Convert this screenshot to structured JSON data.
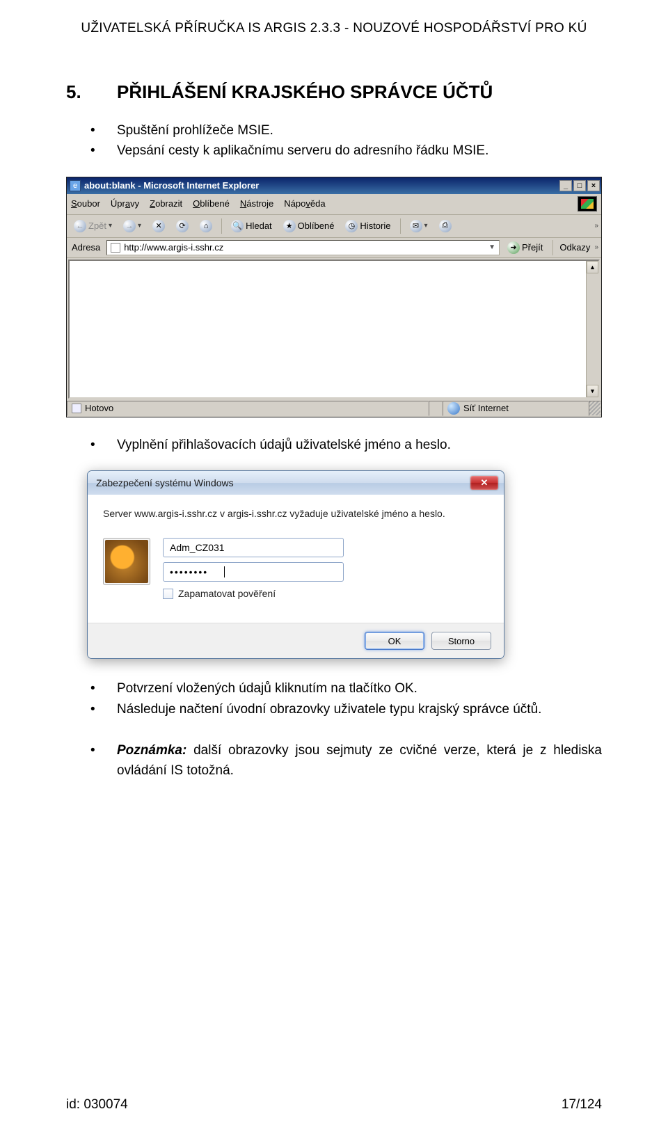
{
  "doc": {
    "header": "UŽIVATELSKÁ PŘÍRUČKA IS ARGIS 2.3.3 - NOUZOVÉ HOSPODÁŘSTVÍ PRO KÚ",
    "footer_left": "id: 030074",
    "footer_right": "17/124"
  },
  "section": {
    "number": "5.",
    "title": "PŘIHLÁŠENÍ KRAJSKÉHO SPRÁVCE ÚČTŮ",
    "b1": "Spuštění prohlížeče MSIE.",
    "b2": "Vepsání cesty k aplikačnímu serveru do adresního řádku MSIE.",
    "b3": "Vyplnění přihlašovacích údajů uživatelské jméno a heslo.",
    "b4": "Potvrzení vložených údajů kliknutím na tlačítko OK.",
    "b5": "Následuje načtení úvodní obrazovky uživatele typu krajský správce účtů.",
    "note_label": "Poznámka:",
    "note_text": " další obrazovky jsou sejmuty ze cvičné verze, která je z hlediska ovládání IS totožná."
  },
  "ie": {
    "title": "about:blank - Microsoft Internet Explorer",
    "menu": {
      "soubor": "Soubor",
      "upravy": "Úpravy",
      "zobrazit": "Zobrazit",
      "oblibene": "Oblíbené",
      "nastroje": "Nástroje",
      "napoveda": "Nápověda"
    },
    "tb": {
      "back": "Zpět",
      "hledat": "Hledat",
      "oblibene": "Oblíbené",
      "historie": "Historie"
    },
    "addr_label": "Adresa",
    "addr_value": "http://www.argis-i.sshr.cz",
    "go": "Přejít",
    "links": "Odkazy",
    "status_left": "Hotovo",
    "status_right": "Síť Internet"
  },
  "w7": {
    "title": "Zabezpečení systému Windows",
    "msg": "Server www.argis-i.sshr.cz v argis-i.sshr.cz vyžaduje uživatelské jméno a heslo.",
    "user": "Adm_CZ031",
    "pass": "••••••••",
    "remember": "Zapamatovat pověření",
    "ok": "OK",
    "cancel": "Storno"
  }
}
